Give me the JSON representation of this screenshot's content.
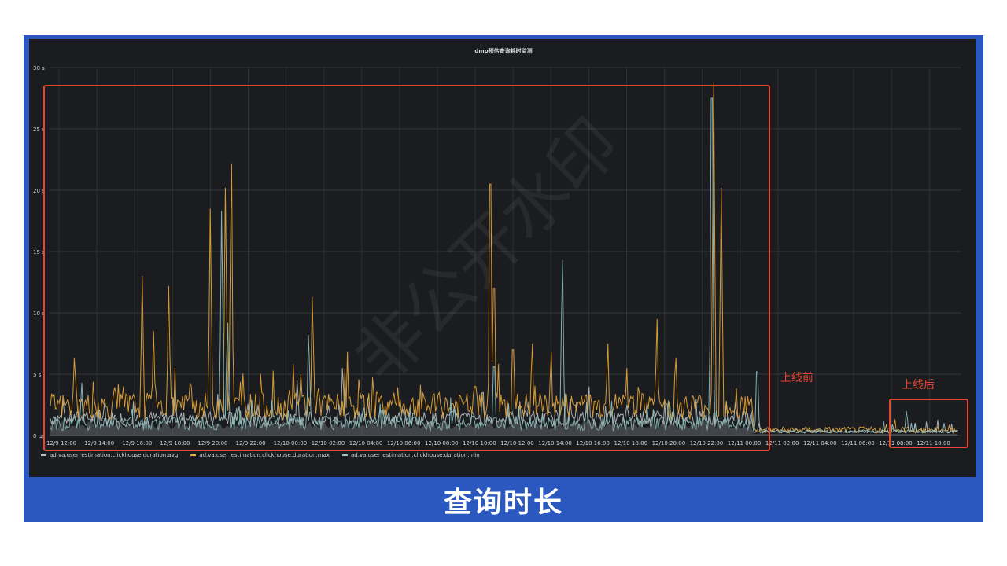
{
  "chart_data": {
    "type": "line",
    "title": "dmp预估查询耗时监测",
    "ylim": [
      0,
      30
    ],
    "y_ticks": [
      "0 µs",
      "5 s",
      "10 s",
      "15 s",
      "20 s",
      "25 s",
      "30 s"
    ],
    "x_ticks": [
      "12/9 12:00",
      "12/9 14:00",
      "12/9 16:00",
      "12/9 18:00",
      "12/9 20:00",
      "12/9 22:00",
      "12/10 00:00",
      "12/10 02:00",
      "12/10 04:00",
      "12/10 06:00",
      "12/10 08:00",
      "12/10 10:00",
      "12/10 12:00",
      "12/10 14:00",
      "12/10 16:00",
      "12/10 18:00",
      "12/10 20:00",
      "12/10 22:00",
      "12/11 00:00",
      "12/11 02:00",
      "12/11 04:00",
      "12/11 06:00",
      "12/11 08:00",
      "12/11 10:00"
    ],
    "grid": true,
    "legend_position": "bottom-left",
    "series": [
      {
        "name": "ad.va.user_estimation.clickhouse.duration.avg",
        "color": "#b5bdbf",
        "spikes": [
          [
            0.3,
            1.2
          ],
          [
            2.0,
            1.0
          ],
          [
            3.1,
            2.0
          ],
          [
            4.2,
            3.4
          ],
          [
            5.0,
            1.5
          ],
          [
            6.3,
            4.5
          ],
          [
            7.5,
            5.5
          ],
          [
            8.5,
            2.0
          ],
          [
            10.0,
            1.0
          ],
          [
            11.2,
            3.5
          ],
          [
            12.3,
            2.0
          ],
          [
            13.5,
            3.0
          ],
          [
            14.0,
            4.0
          ],
          [
            15.0,
            2.5
          ],
          [
            16.0,
            1.5
          ],
          [
            17.0,
            2.0
          ],
          [
            18.5,
            1.0
          ],
          [
            19.5,
            0.5
          ]
        ]
      },
      {
        "name": "ad.va.user_estimation.clickhouse.duration.max",
        "color": "#e8a83a",
        "spikes": [
          [
            0.4,
            6.3
          ],
          [
            1.7,
            4.0
          ],
          [
            2.2,
            13.0
          ],
          [
            2.5,
            8.5
          ],
          [
            2.9,
            12.2
          ],
          [
            3.5,
            4.0
          ],
          [
            4.0,
            18.5
          ],
          [
            4.4,
            20.2
          ],
          [
            4.55,
            22.2
          ],
          [
            6.4,
            5.0
          ],
          [
            6.7,
            11.3
          ],
          [
            8.0,
            3.0
          ],
          [
            8.4,
            3.5
          ],
          [
            11.0,
            4.0
          ],
          [
            11.4,
            20.5
          ],
          [
            11.5,
            12.0
          ],
          [
            12.0,
            7.0
          ],
          [
            12.5,
            7.5
          ],
          [
            13.0,
            6.8
          ],
          [
            14.5,
            7.5
          ],
          [
            15.0,
            5.5
          ],
          [
            15.8,
            9.5
          ],
          [
            16.3,
            6.3
          ],
          [
            17.3,
            28.8
          ],
          [
            17.5,
            20.2
          ]
        ]
      },
      {
        "name": "ad.va.user_estimation.clickhouse.duration.min",
        "color": "#8fc3c2",
        "spikes": [
          [
            0.6,
            4.3
          ],
          [
            4.3,
            18.3
          ],
          [
            4.45,
            9.2
          ],
          [
            6.6,
            8.2
          ],
          [
            11.5,
            5.6
          ],
          [
            13.3,
            14.3
          ],
          [
            17.25,
            27.5
          ],
          [
            18.45,
            5.2
          ],
          [
            22.4,
            2.0
          ]
        ]
      }
    ],
    "annotations": [
      {
        "label": "上线前",
        "color": "#e6462f"
      },
      {
        "label": "上线后",
        "color": "#e6462f"
      }
    ]
  },
  "watermark": "非公开水印",
  "caption": "查询时长",
  "colors": {
    "frame": "#2a58bf",
    "panel": "#1b1c1f",
    "grid": "#34363b",
    "annotation": "#e6462f"
  }
}
